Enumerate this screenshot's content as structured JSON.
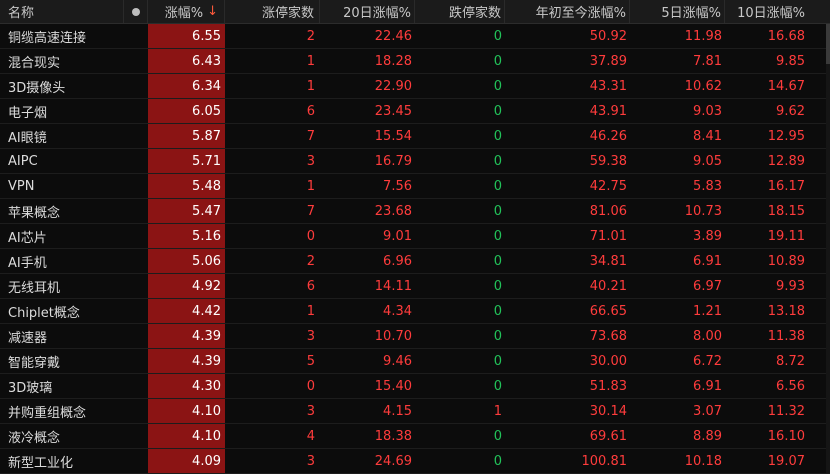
{
  "header": {
    "name": "名称",
    "change_pct": "涨幅%",
    "sort_icon": "arrow-down-icon",
    "limit_up_count": "涨停家数",
    "change_20d": "20日涨幅%",
    "limit_down_count": "跌停家数",
    "ytd_change": "年初至今涨幅%",
    "change_5d": "5日涨幅%",
    "change_10d": "10日涨幅%"
  },
  "colors": {
    "up": "#ff3c3c",
    "flat": "#22c35a",
    "highlight": "#8b1414"
  },
  "rows": [
    {
      "name": "铜缆高速连接",
      "chg": "6.55",
      "up": "2",
      "d20": "22.46",
      "dn": "0",
      "ytd": "50.92",
      "d5": "11.98",
      "d10": "16.68"
    },
    {
      "name": "混合现实",
      "chg": "6.43",
      "up": "1",
      "d20": "18.28",
      "dn": "0",
      "ytd": "37.89",
      "d5": "7.81",
      "d10": "9.85"
    },
    {
      "name": "3D摄像头",
      "chg": "6.34",
      "up": "1",
      "d20": "22.90",
      "dn": "0",
      "ytd": "43.31",
      "d5": "10.62",
      "d10": "14.67"
    },
    {
      "name": "电子烟",
      "chg": "6.05",
      "up": "6",
      "d20": "23.45",
      "dn": "0",
      "ytd": "43.91",
      "d5": "9.03",
      "d10": "9.62"
    },
    {
      "name": "AI眼镜",
      "chg": "5.87",
      "up": "7",
      "d20": "15.54",
      "dn": "0",
      "ytd": "46.26",
      "d5": "8.41",
      "d10": "12.95"
    },
    {
      "name": "AIPC",
      "chg": "5.71",
      "up": "3",
      "d20": "16.79",
      "dn": "0",
      "ytd": "59.38",
      "d5": "9.05",
      "d10": "12.89"
    },
    {
      "name": "VPN",
      "chg": "5.48",
      "up": "1",
      "d20": "7.56",
      "dn": "0",
      "ytd": "42.75",
      "d5": "5.83",
      "d10": "16.17"
    },
    {
      "name": "苹果概念",
      "chg": "5.47",
      "up": "7",
      "d20": "23.68",
      "dn": "0",
      "ytd": "81.06",
      "d5": "10.73",
      "d10": "18.15"
    },
    {
      "name": "AI芯片",
      "chg": "5.16",
      "up": "0",
      "d20": "9.01",
      "dn": "0",
      "ytd": "71.01",
      "d5": "3.89",
      "d10": "19.11"
    },
    {
      "name": "AI手机",
      "chg": "5.06",
      "up": "2",
      "d20": "6.96",
      "dn": "0",
      "ytd": "34.81",
      "d5": "6.91",
      "d10": "10.89"
    },
    {
      "name": "无线耳机",
      "chg": "4.92",
      "up": "6",
      "d20": "14.11",
      "dn": "0",
      "ytd": "40.21",
      "d5": "6.97",
      "d10": "9.93"
    },
    {
      "name": "Chiplet概念",
      "chg": "4.42",
      "up": "1",
      "d20": "4.34",
      "dn": "0",
      "ytd": "66.65",
      "d5": "1.21",
      "d10": "13.18"
    },
    {
      "name": "减速器",
      "chg": "4.39",
      "up": "3",
      "d20": "10.70",
      "dn": "0",
      "ytd": "73.68",
      "d5": "8.00",
      "d10": "11.38"
    },
    {
      "name": "智能穿戴",
      "chg": "4.39",
      "up": "5",
      "d20": "9.46",
      "dn": "0",
      "ytd": "30.00",
      "d5": "6.72",
      "d10": "8.72"
    },
    {
      "name": "3D玻璃",
      "chg": "4.30",
      "up": "0",
      "d20": "15.40",
      "dn": "0",
      "ytd": "51.83",
      "d5": "6.91",
      "d10": "6.56"
    },
    {
      "name": "并购重组概念",
      "chg": "4.10",
      "up": "3",
      "d20": "4.15",
      "dn": "1",
      "ytd": "30.14",
      "d5": "3.07",
      "d10": "11.32"
    },
    {
      "name": "液冷概念",
      "chg": "4.10",
      "up": "4",
      "d20": "18.38",
      "dn": "0",
      "ytd": "69.61",
      "d5": "8.89",
      "d10": "16.10"
    },
    {
      "name": "新型工业化",
      "chg": "4.09",
      "up": "3",
      "d20": "24.69",
      "dn": "0",
      "ytd": "100.81",
      "d5": "10.18",
      "d10": "19.07"
    }
  ]
}
